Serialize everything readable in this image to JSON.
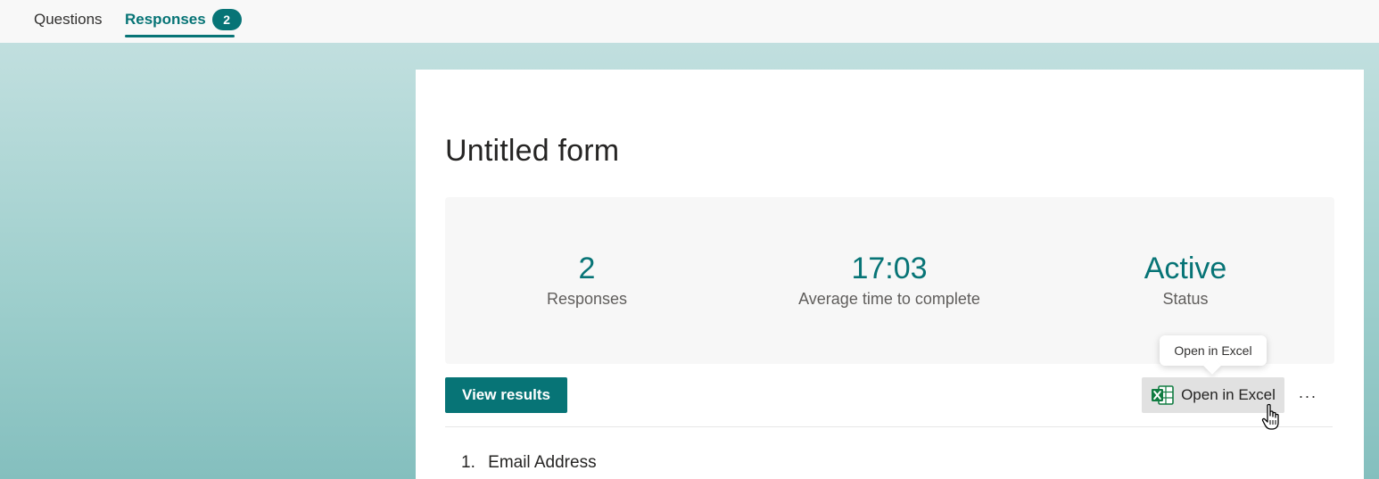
{
  "tabs": {
    "questions_label": "Questions",
    "responses_label": "Responses",
    "responses_count": "2"
  },
  "form": {
    "title": "Untitled form"
  },
  "stats": {
    "responses_value": "2",
    "responses_label": "Responses",
    "avg_time_value": "17:03",
    "avg_time_label": "Average time to complete",
    "status_value": "Active",
    "status_label": "Status"
  },
  "actions": {
    "view_results_label": "View results",
    "open_excel_label": "Open in Excel",
    "more_label": "···",
    "tooltip_text": "Open in Excel"
  },
  "questions": [
    {
      "number": "1.",
      "label": "Email Address"
    }
  ],
  "colors": {
    "accent": "#077476",
    "excel_green": "#107c41"
  },
  "icons": {
    "excel": "excel-icon",
    "more": "more-options-icon",
    "cursor": "hand-pointer-cursor"
  }
}
